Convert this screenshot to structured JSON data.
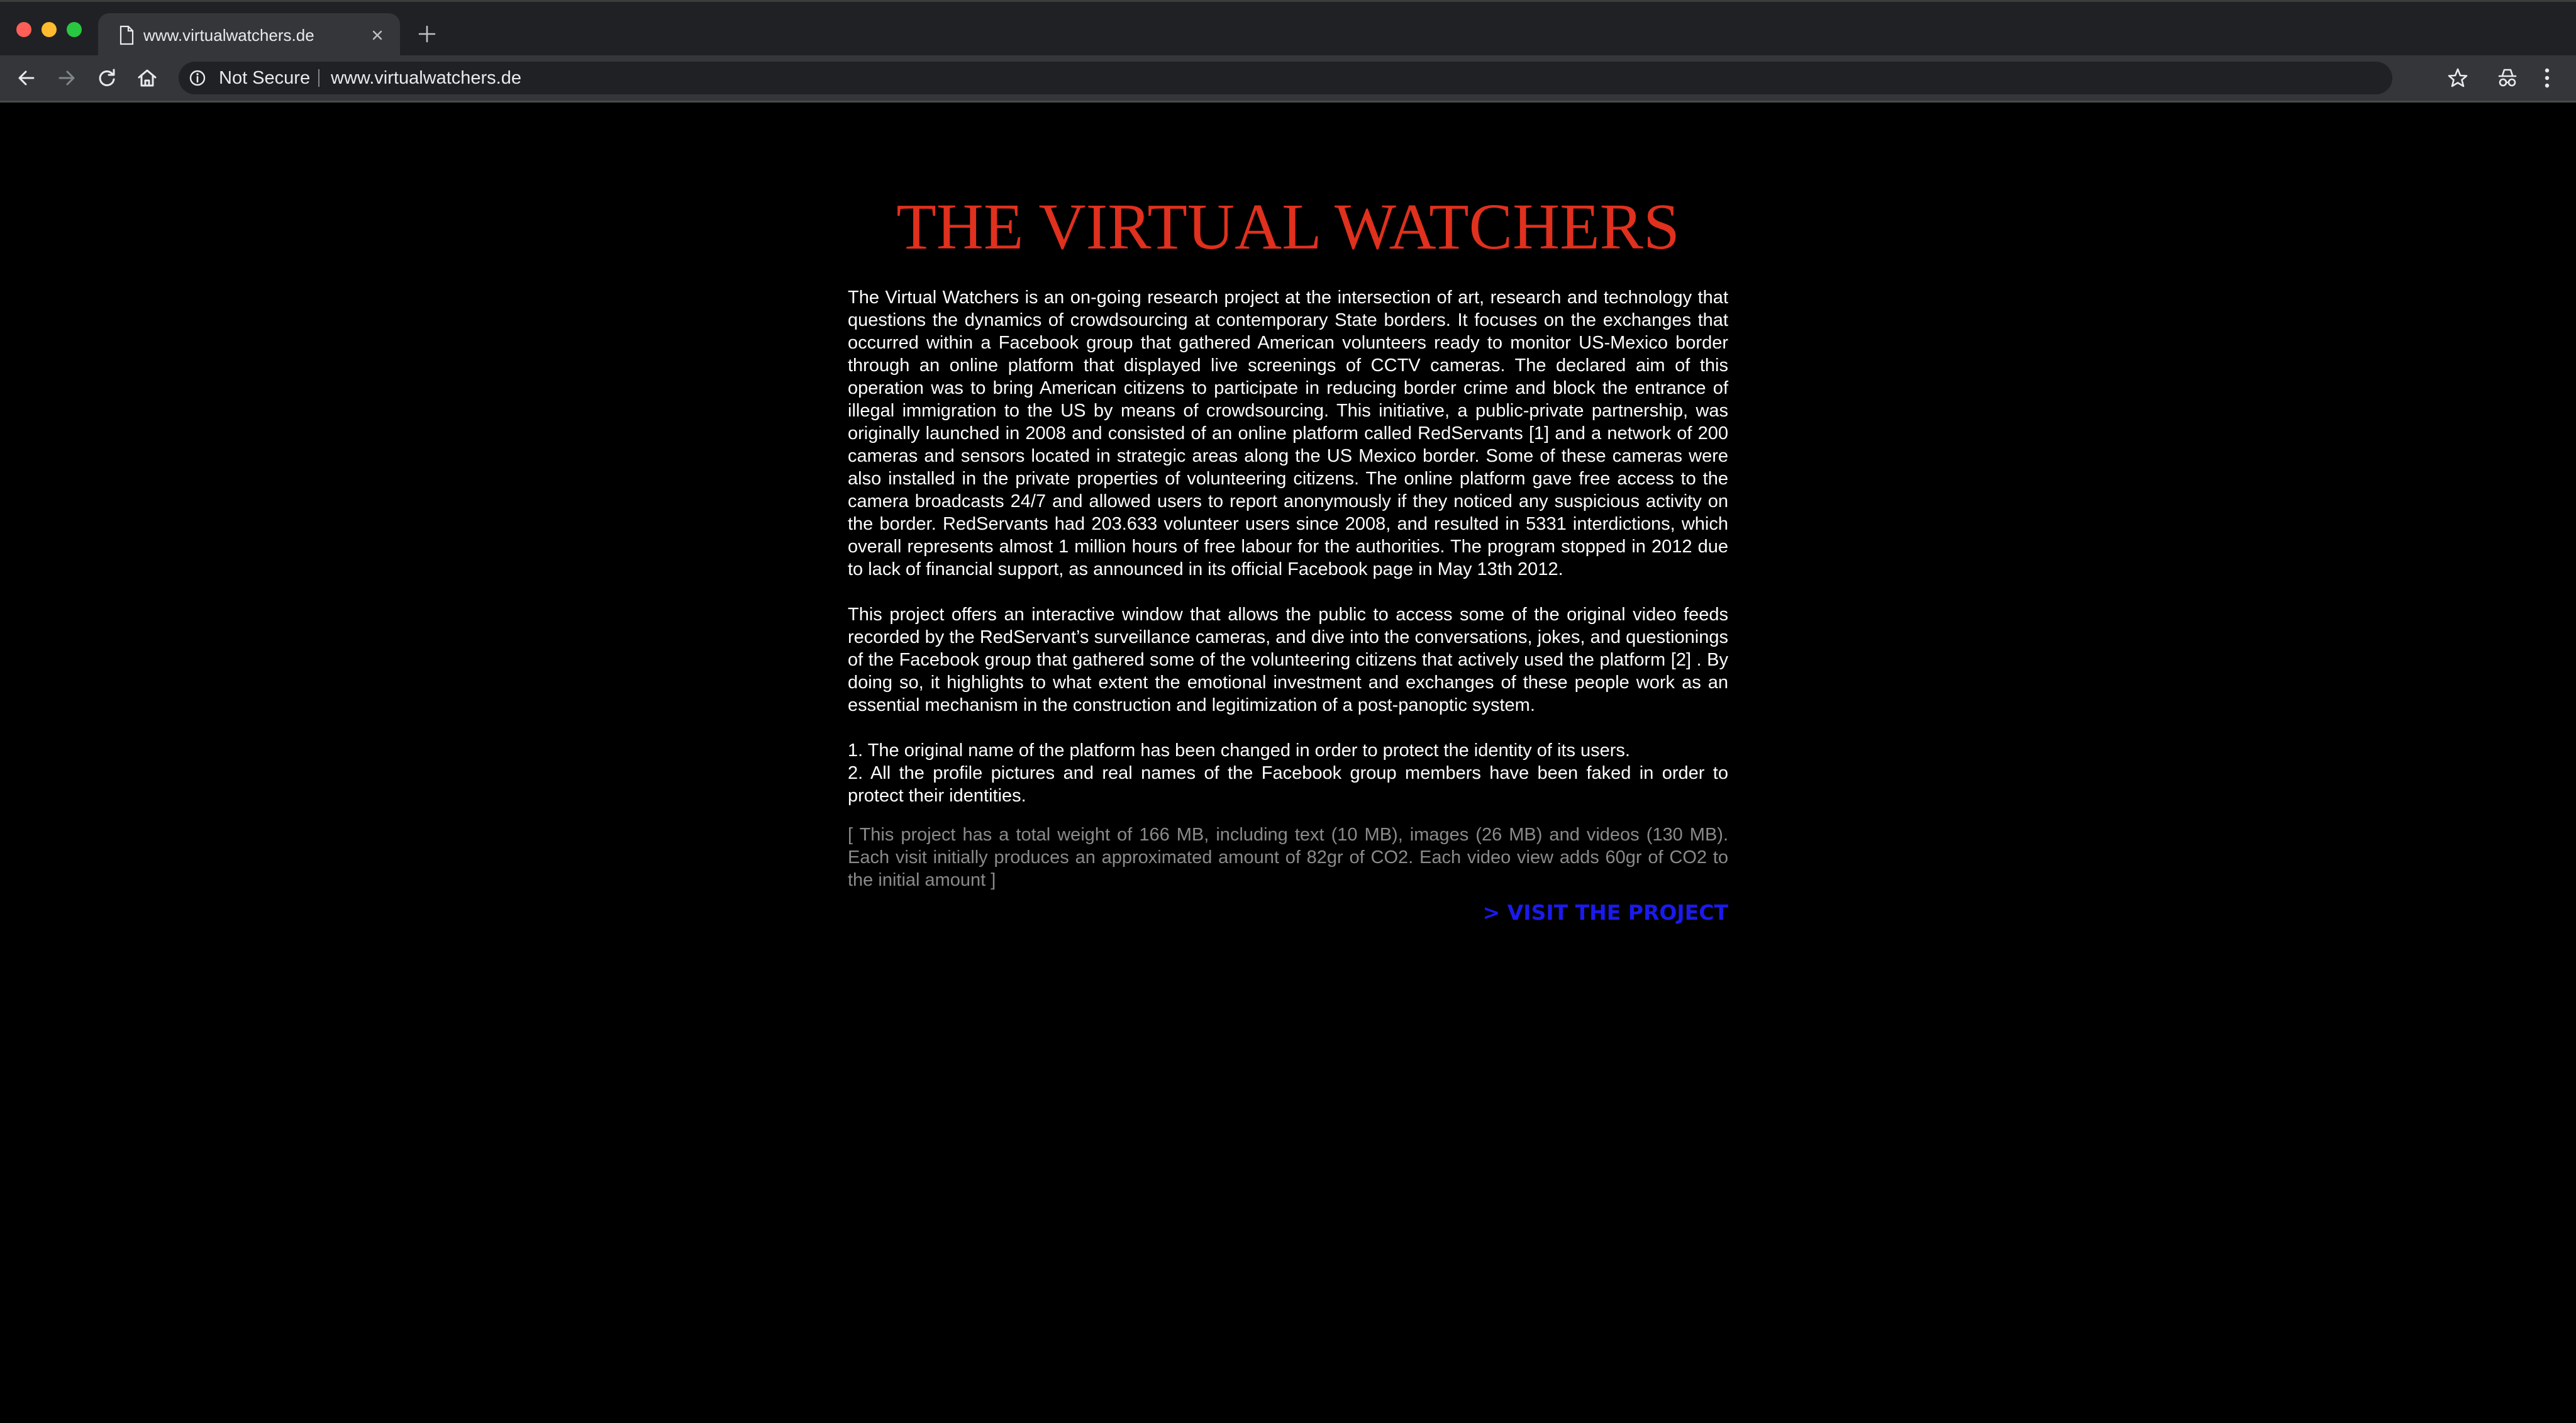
{
  "browser": {
    "tab": {
      "title": "www.virtualwatchers.de"
    },
    "omnibox": {
      "security_label": "Not Secure",
      "url": "www.virtualwatchers.de"
    }
  },
  "page": {
    "title": "THE VIRTUAL WATCHERS",
    "paragraph_1": "The Virtual Watchers is an on-going research project at the intersection of art, research and technology that questions the dynamics of crowdsourcing at contemporary State borders. It focuses on the exchanges that occurred within a Facebook group that gathered American volunteers ready to monitor US-Mexico border through an online platform that displayed live screenings of CCTV cameras. The declared aim of this operation was to bring American citizens to participate in reducing border crime and block the entrance of illegal immigration to the US by means of crowdsourcing. This initiative, a public-private partnership, was originally launched in 2008 and consisted of an online platform called RedServants [1] and a network of 200 cameras and sensors located in strategic areas along the US Mexico border. Some of these cameras were also installed in the private properties of volunteering citizens. The online platform gave free access to the camera broadcasts 24/7 and allowed users to report anonymously if they noticed any suspicious activity on the border. RedServants had 203.633 volunteer users since 2008, and resulted in 5331 interdictions, which overall represents almost 1 million hours of free labour for the authorities. The program stopped in 2012 due to lack of financial support, as announced in its official Facebook page in May 13th 2012.",
    "paragraph_2": "This project offers an interactive window that allows the public to access some of the original video feeds recorded by the RedServant’s surveillance cameras, and dive into the conversations, jokes, and questionings of the Facebook group that gathered some of the volunteering citizens that actively used the platform [2] . By doing so, it highlights to what extent the emotional investment and exchanges of these people work as an essential mechanism in the construction and legitimization of a post-panoptic system.",
    "notes": [
      "1. The original name of the platform has been changed in order to protect the identity of its users.",
      "2. All the profile pictures and real names of the Facebook group members have been faked in order to protect their identities."
    ],
    "footprint": "[ This project has a total weight of 166 MB, including text (10 MB), images (26 MB) and videos (130 MB). Each visit initially produces an approximated amount of 82gr of CO2. Each video view adds 60gr of CO2 to the initial amount ]",
    "visit_link": "> VISIT THE PROJECT"
  },
  "icons": {
    "tab_favicon": "page-icon",
    "tab_close": "close-icon",
    "new_tab": "plus-icon",
    "back": "arrow-left-icon",
    "forward": "arrow-right-icon",
    "reload": "reload-icon",
    "home": "home-icon",
    "security": "info-icon",
    "bookmark": "star-icon",
    "incognito": "incognito-icon",
    "menu": "kebab-menu-icon"
  },
  "colors": {
    "page_background": "#000000",
    "title": "#e0301e",
    "body_text": "#ffffff",
    "footprint_text": "#8a8a8a",
    "link": "#1a1aee",
    "chrome_frame": "#202124",
    "chrome_toolbar": "#35363a"
  }
}
